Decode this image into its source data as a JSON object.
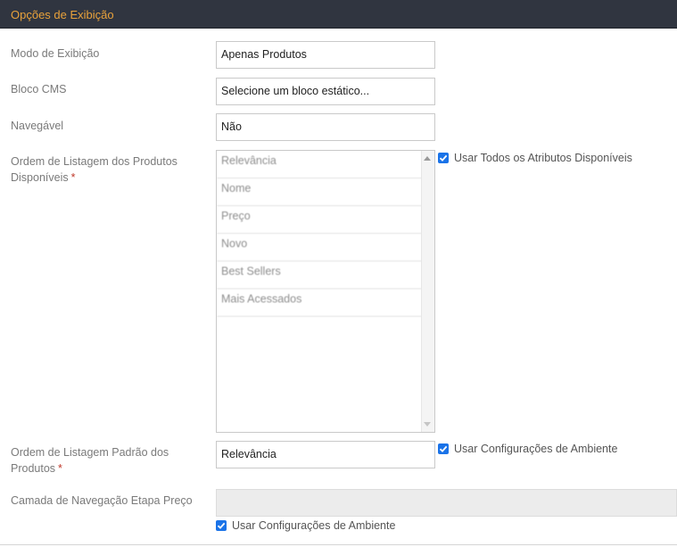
{
  "panel": {
    "title": "Opções de Exibição"
  },
  "fields": {
    "display_mode": {
      "label": "Modo de Exibição",
      "value": "Apenas Produtos"
    },
    "cms_block": {
      "label": "Bloco CMS",
      "value": "Selecione um bloco estático..."
    },
    "anchor": {
      "label": "Navegável",
      "value": "Não"
    },
    "available_sort": {
      "label": "Ordem de Listagem dos Produtos Disponíveis",
      "required_mark": "*",
      "options": [
        "Relevância",
        "Nome",
        "Preço",
        "Novo",
        "Best Sellers",
        "Mais Acessados"
      ],
      "use_all_label": "Usar Todos os Atributos Disponíveis",
      "use_all_checked": true
    },
    "default_sort": {
      "label": "Ordem de Listagem Padrão dos Produtos",
      "required_mark": "*",
      "value": "Relevância",
      "use_config_label": "Usar Configurações de Ambiente",
      "use_config_checked": true
    },
    "price_step": {
      "label": "Camada de Navegação Etapa Preço",
      "value": "",
      "use_config_label": "Usar Configurações de Ambiente",
      "use_config_checked": true
    }
  },
  "colors": {
    "header_bg": "#303540",
    "header_text": "#e9a23b",
    "checkbox": "#1a73e8",
    "required": "#c0392b"
  }
}
